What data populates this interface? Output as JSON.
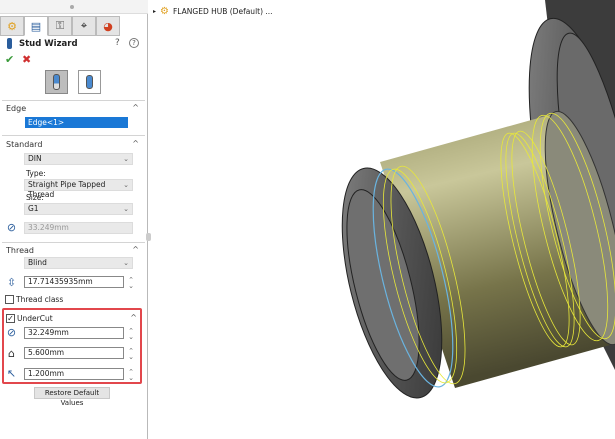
{
  "panel": {
    "tabs": [
      {
        "icon": "feature-manager-icon"
      },
      {
        "icon": "property-manager-icon"
      },
      {
        "icon": "configuration-manager-icon"
      },
      {
        "icon": "dimxpert-icon"
      },
      {
        "icon": "display-manager-icon"
      }
    ],
    "title": "Stud Wizard",
    "edge": {
      "label": "Edge",
      "value": "Edge<1>"
    },
    "standard": {
      "label": "Standard",
      "standard_value": "DIN",
      "type_label": "Type:",
      "type_value": "Straight Pipe Tapped Thread",
      "size_label": "Size:",
      "size_value": "G1",
      "diameter": "33.249mm"
    },
    "thread": {
      "label": "Thread",
      "end_condition": "Blind",
      "depth": "17.71435935mm",
      "thread_class_label": "Thread class",
      "thread_class_checked": false
    },
    "undercut": {
      "label": "UnderCut",
      "checked": true,
      "diameter": "32.249mm",
      "depth": "5.600mm",
      "radius": "1.200mm"
    },
    "restore_label": "Restore Default Values"
  },
  "viewport": {
    "tree_item": "FLANGED HUB (Default) ...",
    "highlight_color": "#e2474c",
    "thread_color": "#e8e83a",
    "selection_color": "#6ab4e0"
  }
}
